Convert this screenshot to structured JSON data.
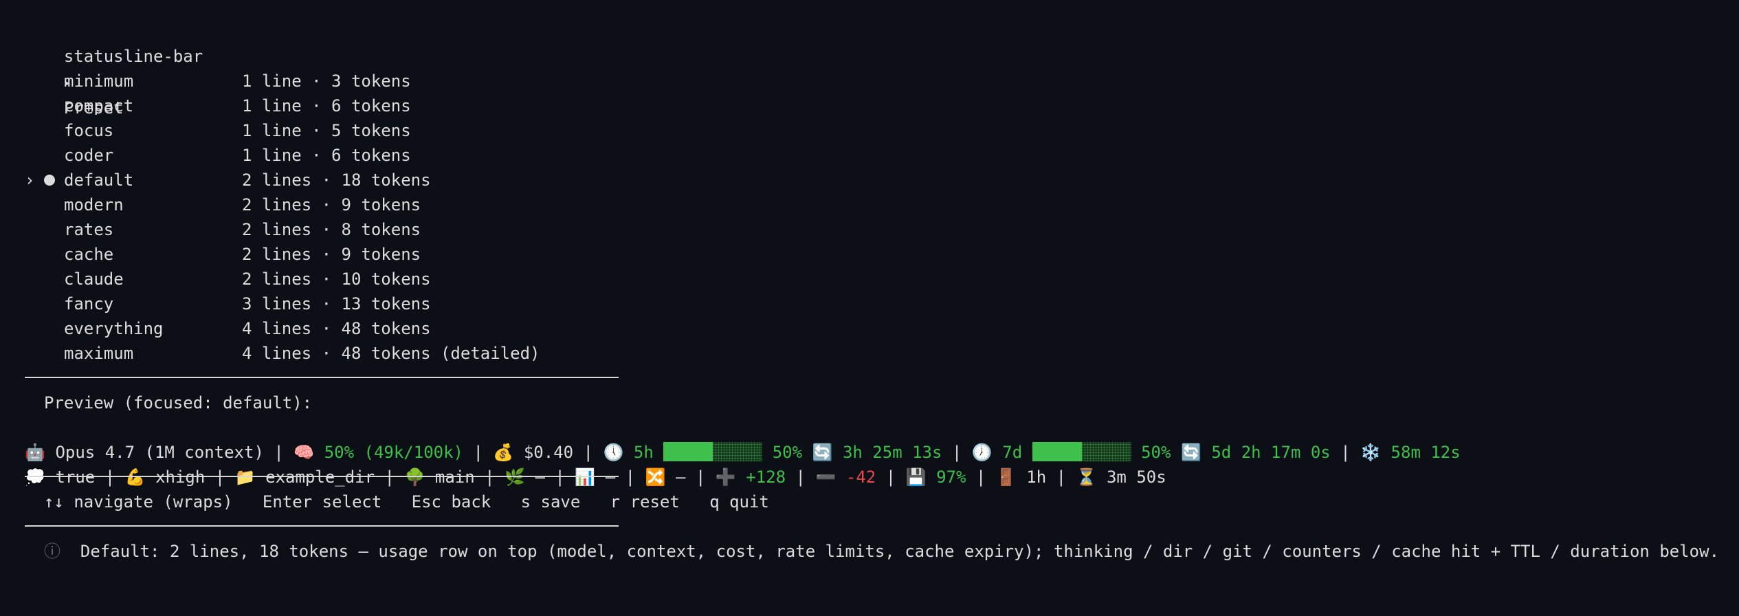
{
  "breadcrumb": {
    "app": "statusline-bar",
    "arrow": "▸",
    "page": "Preset"
  },
  "presets": [
    {
      "name": "minimum",
      "desc": "1 line · 3 tokens"
    },
    {
      "name": "compact",
      "desc": "1 line · 6 tokens"
    },
    {
      "name": "focus",
      "desc": "1 line · 5 tokens"
    },
    {
      "name": "coder",
      "desc": "1 line · 6 tokens"
    },
    {
      "name": "default",
      "desc": "2 lines · 18 tokens"
    },
    {
      "name": "modern",
      "desc": "2 lines · 9 tokens"
    },
    {
      "name": "rates",
      "desc": "2 lines · 8 tokens"
    },
    {
      "name": "cache",
      "desc": "2 lines · 9 tokens"
    },
    {
      "name": "claude",
      "desc": "2 lines · 10 tokens"
    },
    {
      "name": "fancy",
      "desc": "3 lines · 13 tokens"
    },
    {
      "name": "everything",
      "desc": "4 lines · 48 tokens"
    },
    {
      "name": "maximum",
      "desc": "4 lines · 48 tokens (detailed)"
    }
  ],
  "selected_index": 4,
  "cursor_glyph": "›",
  "preview": {
    "heading": "Preview (focused: default):",
    "line1": {
      "model_icon": "🤖",
      "model": "Opus 4.7 (1M context)",
      "divider": "|",
      "context_icon": "🧠",
      "context": "50% (49k/100k)",
      "cost_icon": "💰",
      "cost": "$0.40",
      "clock5_icon": "🕔",
      "window5": "5h",
      "window5_fill": 0.5,
      "window5_pct": "50%",
      "refresh_icon": "🔄",
      "window5_reset": "3h 25m 13s",
      "clock7_icon": "🕖",
      "window7": "7d",
      "window7_fill": 0.5,
      "window7_pct": "50%",
      "window7_reset": "5d 2h 17m 0s",
      "cache_icon": "❄️",
      "cache_ttl": "58m 12s"
    },
    "line2": {
      "thinking_icon": "💭",
      "thinking": "true",
      "effort_icon": "💪",
      "effort": "xhigh",
      "dir_icon": "📁",
      "dir": "example_dir",
      "branch_icon": "🌳",
      "branch": "main",
      "leaf_icon": "🌿",
      "leaf": "—",
      "chart_icon": "📊",
      "chart": "—",
      "shuffle_icon": "🔀",
      "shuffle": "—",
      "plus_icon": "➕",
      "added": "+128",
      "minus_icon": "➖",
      "removed": "-42",
      "disk_icon": "💾",
      "cache_hit": "97%",
      "door_icon": "🚪",
      "ttl": "1h",
      "hourglass_icon": "⏳",
      "duration": "3m 50s"
    }
  },
  "keys": {
    "navigate": "↑↓ navigate (wraps)",
    "select": "Enter select",
    "back": "Esc back",
    "save": "s save",
    "reset": "r reset",
    "quit": "q quit"
  },
  "info": {
    "icon": "ⓘ",
    "text": "Default: 2 lines, 18 tokens — usage row on top (model, context, cost, rate limits, cache expiry); thinking / dir / git / counters / cache hit + TTL / duration below."
  },
  "colors": {
    "background": "#0c0f16",
    "text": "#dcdcdc",
    "green": "#3fbf4c",
    "red": "#e5484d"
  }
}
